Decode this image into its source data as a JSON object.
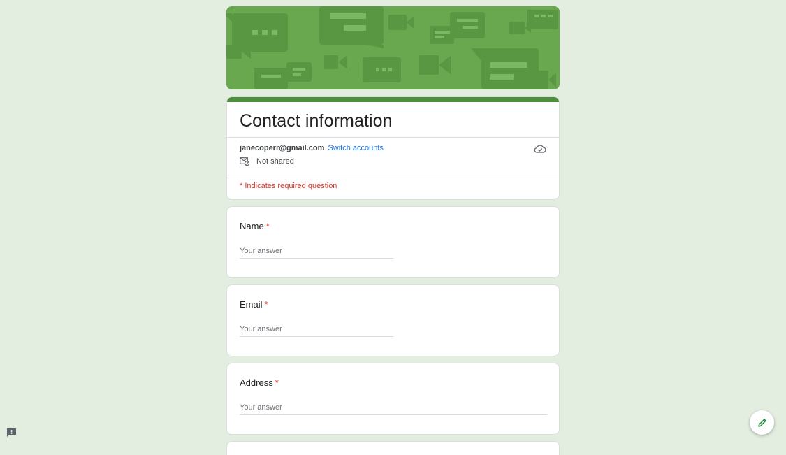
{
  "form": {
    "title": "Contact information",
    "account_email": "janecoperr@gmail.com",
    "switch_label": "Switch accounts",
    "not_shared_label": "Not shared",
    "required_note": "* Indicates required question"
  },
  "questions": [
    {
      "label": "Name",
      "placeholder": "Your answer"
    },
    {
      "label": "Email",
      "placeholder": "Your answer"
    },
    {
      "label": "Address",
      "placeholder": "Your answer"
    }
  ],
  "required_marker": "*",
  "icons": {
    "cloud": "cloud-icon",
    "not_shared": "mail-crossed-icon",
    "report": "report-icon",
    "edit": "pencil-icon"
  },
  "colors": {
    "background": "#e3eee0",
    "banner": "#6aa84f",
    "accent": "#4d8f3a",
    "link": "#1a73e8",
    "required": "#d93025"
  }
}
